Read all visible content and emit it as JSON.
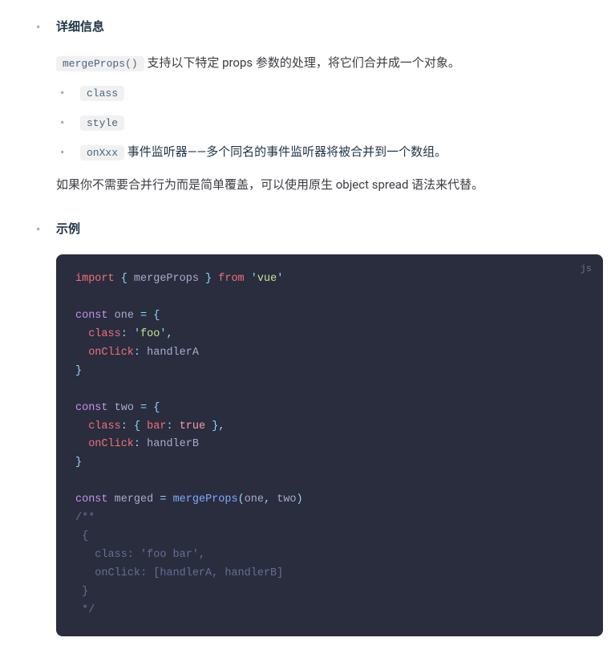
{
  "details": {
    "title": "详细信息",
    "intro_code": "mergeProps()",
    "intro_text": " 支持以下特定 props 参数的处理，将它们合并成一个对象。",
    "list": [
      {
        "code": "class",
        "text": ""
      },
      {
        "code": "style",
        "text": ""
      },
      {
        "code": "onXxx",
        "text": " 事件监听器——多个同名的事件监听器将被合并到一个数组。"
      }
    ],
    "note": "如果你不需要合并行为而是简单覆盖，可以使用原生 object spread 语法来代替。"
  },
  "example": {
    "title": "示例",
    "lang": "js",
    "code": {
      "l1_import": "import",
      "l1_b1": " { ",
      "l1_name": "mergeProps",
      "l1_b2": " } ",
      "l1_from": "from",
      "l1_sp": " ",
      "l1_q1": "'",
      "l1_str": "vue",
      "l1_q2": "'",
      "l3_const": "const",
      "l3_sp": " ",
      "l3_var": "one",
      "l3_sp2": " ",
      "l3_eq": "=",
      "l3_sp3": " ",
      "l3_b": "{",
      "l4_indent": "  ",
      "l4_prop": "class",
      "l4_colon": ":",
      "l4_sp": " ",
      "l4_q1": "'",
      "l4_str": "foo",
      "l4_q2": "'",
      "l4_comma": ",",
      "l5_indent": "  ",
      "l5_prop": "onClick",
      "l5_colon": ":",
      "l5_sp": " ",
      "l5_val": "handlerA",
      "l6_b": "}",
      "l8_const": "const",
      "l8_sp": " ",
      "l8_var": "two",
      "l8_sp2": " ",
      "l8_eq": "=",
      "l8_sp3": " ",
      "l8_b": "{",
      "l9_indent": "  ",
      "l9_prop": "class",
      "l9_colon": ":",
      "l9_sp": " ",
      "l9_b1": "{",
      "l9_sp2": " ",
      "l9_key": "bar",
      "l9_colon2": ":",
      "l9_sp3": " ",
      "l9_bool": "true",
      "l9_sp4": " ",
      "l9_b2": "}",
      "l9_comma": ",",
      "l10_indent": "  ",
      "l10_prop": "onClick",
      "l10_colon": ":",
      "l10_sp": " ",
      "l10_val": "handlerB",
      "l11_b": "}",
      "l13_const": "const",
      "l13_sp": " ",
      "l13_var": "merged",
      "l13_sp2": " ",
      "l13_eq": "=",
      "l13_sp3": " ",
      "l13_fn": "mergeProps",
      "l13_p1": "(",
      "l13_a1": "one",
      "l13_comma": ",",
      "l13_sp4": " ",
      "l13_a2": "two",
      "l13_p2": ")",
      "c1": "/**",
      "c2": " {",
      "c3": "   class: 'foo bar',",
      "c4": "   onClick: [handlerA, handlerB]",
      "c5": " }",
      "c6": " */"
    }
  }
}
